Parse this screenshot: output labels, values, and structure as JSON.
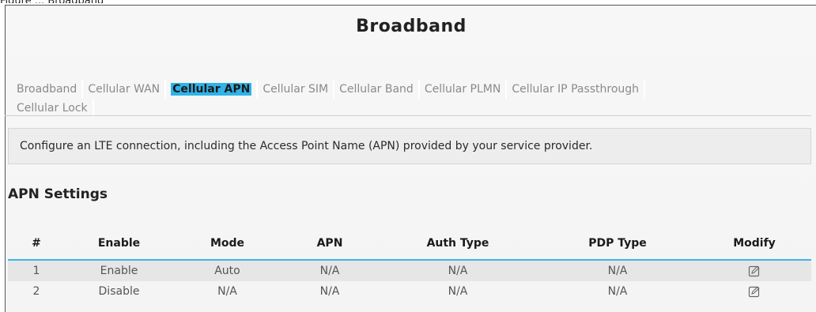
{
  "caption": "Figure ... Broadband",
  "page": {
    "title": "Broadband"
  },
  "tabs": [
    {
      "label": "Broadband",
      "active": false
    },
    {
      "label": "Cellular WAN",
      "active": false
    },
    {
      "label": "Cellular APN",
      "active": true
    },
    {
      "label": "Cellular SIM",
      "active": false
    },
    {
      "label": "Cellular Band",
      "active": false
    },
    {
      "label": "Cellular PLMN",
      "active": false
    },
    {
      "label": "Cellular IP Passthrough",
      "active": false
    },
    {
      "label": "Cellular Lock",
      "active": false
    }
  ],
  "info": {
    "text": "Configure an LTE connection, including the Access Point Name (APN) provided by your service provider."
  },
  "section": {
    "title": "APN Settings"
  },
  "table": {
    "headers": [
      "#",
      "Enable",
      "Mode",
      "APN",
      "Auth Type",
      "PDP Type",
      "Modify"
    ],
    "rows": [
      {
        "num": "1",
        "enable": "Enable",
        "mode": "Auto",
        "apn": "N/A",
        "auth": "N/A",
        "pdp": "N/A",
        "modify_icon": "edit-icon"
      },
      {
        "num": "2",
        "enable": "Disable",
        "mode": "N/A",
        "apn": "N/A",
        "auth": "N/A",
        "pdp": "N/A",
        "modify_icon": "edit-icon"
      }
    ]
  },
  "colors": {
    "accent": "#2fb3e8",
    "header_rule": "#3fb4e6"
  }
}
